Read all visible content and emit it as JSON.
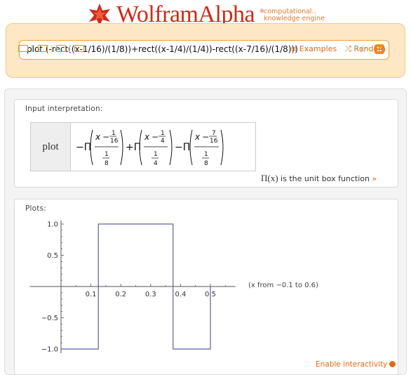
{
  "header": {
    "brand": "WolframAlpha",
    "tagline_line1": "computational..",
    "tagline_line2": "knowledge engine",
    "reg_mark": "®"
  },
  "search": {
    "query": "plot (-rect((x-1/16)/(1/8))+rect((x-1/4)/(1/4))-rect((x-7/16)/(1/8)))",
    "examples_label": "Examples",
    "random_label": "Random",
    "examples_icon": "list-icon",
    "random_icon": "shuffle-icon"
  },
  "input_interpretation": {
    "title": "Input interpretation:",
    "command": "plot",
    "footnote_symbol": "Π(x)",
    "footnote_text": "is the unit box function",
    "footnote_more": "»"
  },
  "plots": {
    "title": "Plots:",
    "range_note": "(x from −0.1 to 0.6)",
    "enable_label": "Enable interactivity"
  },
  "chart_data": {
    "type": "line",
    "title": "",
    "xlabel": "",
    "ylabel": "",
    "xlim": [
      -0.1,
      0.6
    ],
    "ylim": [
      -1.0,
      1.0
    ],
    "x_ticks": [
      0.1,
      0.2,
      0.3,
      0.4,
      0.5
    ],
    "x_tick_labels": [
      "0.1",
      "0.2",
      "0.3",
      "0.4",
      "0.5"
    ],
    "y_ticks": [
      1.0,
      0.5,
      -0.5,
      -1.0
    ],
    "y_tick_labels": [
      "1.0",
      "0.5",
      "−0.5",
      "−1.0"
    ],
    "series": [
      {
        "color": "#5e5ea8",
        "x": [
          0.0,
          0.125,
          0.125,
          0.375,
          0.375,
          0.5,
          0.5
        ],
        "y": [
          -1.0,
          -1.0,
          1.0,
          1.0,
          -1.0,
          -1.0,
          0.0
        ]
      }
    ],
    "grid": false
  }
}
